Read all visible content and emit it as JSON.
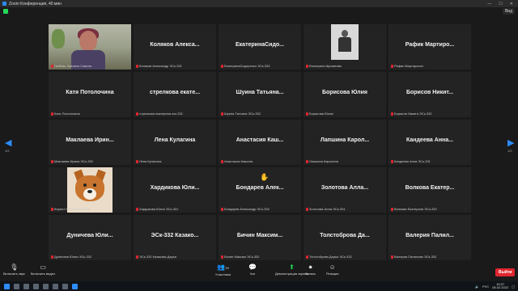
{
  "window": {
    "title": "Zoom Конференция, 40 мин"
  },
  "view_button": "Вид",
  "pager": {
    "left": "1/2",
    "right": "1/2"
  },
  "tiles": [
    {
      "big": "",
      "name": "Любовь Львовна Савина",
      "kind": "video-woman",
      "active": true
    },
    {
      "big": "Коляков Алекса...",
      "name": "Коляков Александр ЭСк-331"
    },
    {
      "big": "ЕкатеринаСидо...",
      "name": "ЕкатеринаСидоренко ЭСк-332"
    },
    {
      "big": "",
      "name": "Екатерина Щипанова",
      "kind": "photo"
    },
    {
      "big": "Рафик Мартиро...",
      "name": "Рафик Мартиросян"
    },
    {
      "big": "Катя Потолочина",
      "name": "Катя Потолочина"
    },
    {
      "big": "стрелкова екате...",
      "name": "стрелкова екатерина эск-331"
    },
    {
      "big": "Шуина Татьяна...",
      "name": "Шуина Татьяна ЭСк-332"
    },
    {
      "big": "Борисова Юлия",
      "name": "Борисова Юлия"
    },
    {
      "big": "Борисов Никит...",
      "name": "Борисов Никита ЭСк-332"
    },
    {
      "big": "Маклаева Ирин...",
      "name": "Маклаева Ирина ЭСк-332"
    },
    {
      "big": "Лена Кулагина",
      "name": "Лена Кулагина"
    },
    {
      "big": "Анастасия Каш...",
      "name": "Анастасия Кашина"
    },
    {
      "big": "Лапшина Карол...",
      "name": "Лапшина Каролина"
    },
    {
      "big": "Кандеева Анна...",
      "name": "Кандеева Анна ЭСк-331"
    },
    {
      "big": "",
      "name": "Кирилл Петров ЭСк-332",
      "kind": "dog"
    },
    {
      "big": "Хардикова Юли...",
      "name": "Хардикова Юлия ЭСк-331"
    },
    {
      "big": "Бондарев Алек...",
      "name": "Бондарев Александр ЭСк-332"
    },
    {
      "big": "Золотова Алла...",
      "name": "Золотова Алла ЭСк-331"
    },
    {
      "big": "Волкова Екатер...",
      "name": "Волкова Екатерина ЭСк-332"
    },
    {
      "big": "Дуничева Юли...",
      "name": "Дуничева Юлия ЭСк-332"
    },
    {
      "big": "ЭСк-332 Казако...",
      "name": "ЭСк-332 Казакова Дарья"
    },
    {
      "big": "Бичин Максим...",
      "name": "Бичин Максим ЭСк-332"
    },
    {
      "big": "Толстоброва Да...",
      "name": "Толстоброва Дарья ЭСк-332"
    },
    {
      "big": "Валерия Палил...",
      "name": "Валерия Палилова ЭСк-332"
    }
  ],
  "toolbar": {
    "mute": "Включить звук",
    "video": "Включить видео",
    "participants": "Участники",
    "participants_count": "29",
    "chat": "Чат",
    "share": "Демонстрация экрана",
    "record": "Запись",
    "reactions": "Реакции",
    "leave": "Выйти"
  },
  "taskbar": {
    "lang": "РУС",
    "time": "15:07",
    "date": "08.02.2022"
  }
}
